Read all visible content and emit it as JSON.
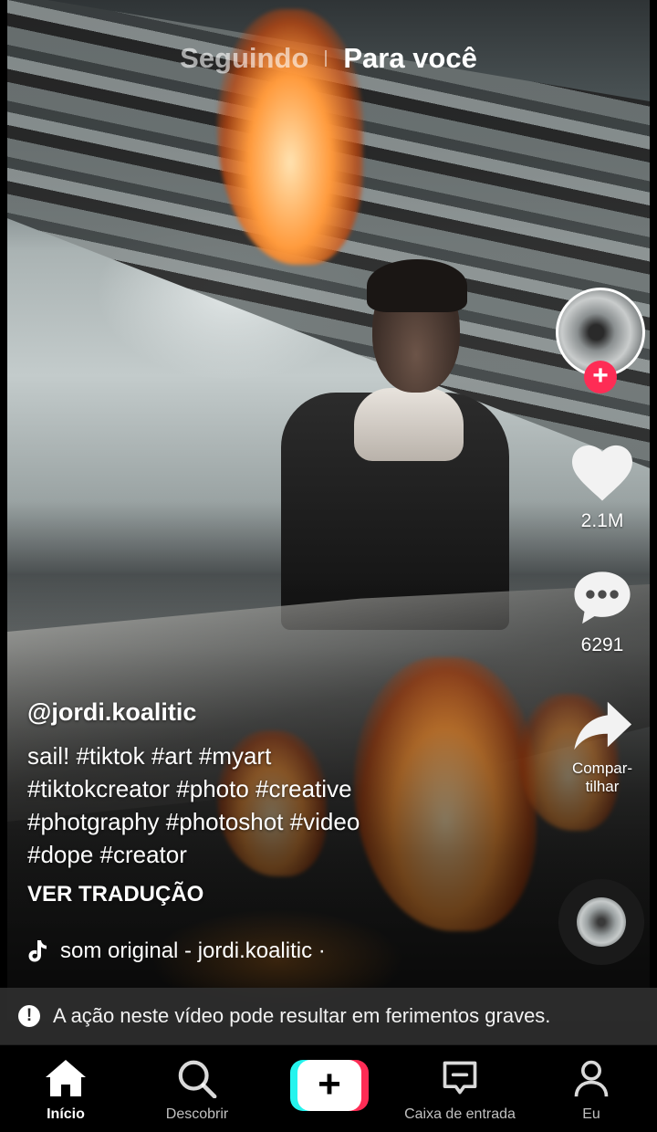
{
  "top_tabs": {
    "following": "Seguindo",
    "for_you": "Para você"
  },
  "creator": {
    "avatar_icon": "creator-avatar",
    "follow_symbol": "+"
  },
  "actions": {
    "likes": "2.1M",
    "comments": "6291",
    "share_label_line1": "Compar-",
    "share_label_line2": "tilhar"
  },
  "caption": {
    "username": "@jordi.koalitic",
    "lines": [
      "sail! #tiktok #art #myart",
      "#tiktokcreator #photo #creative",
      "#photgraphy #photoshot #video",
      "#dope #creator"
    ],
    "translate": "VER TRADUÇÃO"
  },
  "sound": {
    "icon": "music-note-icon",
    "text": "som original - jordi.koalitic ·"
  },
  "warning": {
    "icon": "exclamation-icon",
    "text": "A ação neste vídeo pode resultar em ferimentos graves."
  },
  "nav": {
    "home": "Início",
    "discover": "Descobrir",
    "create_symbol": "+",
    "inbox": "Caixa de entrada",
    "me": "Eu"
  },
  "colors": {
    "accent_red": "#fe2c55",
    "accent_cyan": "#25f4ee"
  }
}
